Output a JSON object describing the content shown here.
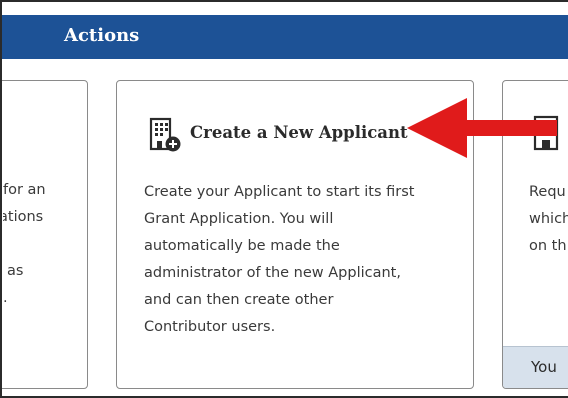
{
  "header": {
    "title": "Actions"
  },
  "left_card": {
    "lines": [
      "for an",
      "ations",
      "",
      "as",
      "."
    ]
  },
  "main_card": {
    "icon": "building-plus-icon",
    "title": "Create a New Applicant",
    "description_lines": [
      "Create your Applicant to start its first",
      "Grant Application. You will",
      "automatically be made the",
      "administrator of the new Applicant,",
      "and can then create other",
      "Contributor users."
    ]
  },
  "right_card": {
    "icon": "building-icon",
    "lines": [
      "Requ",
      "which",
      "on th"
    ],
    "footer_text": "You"
  },
  "annotation": {
    "icon": "red-arrow-left",
    "color": "#e01b1b"
  },
  "colors": {
    "header_bg": "#1d5296",
    "footer_bg": "#d7e1ec"
  }
}
